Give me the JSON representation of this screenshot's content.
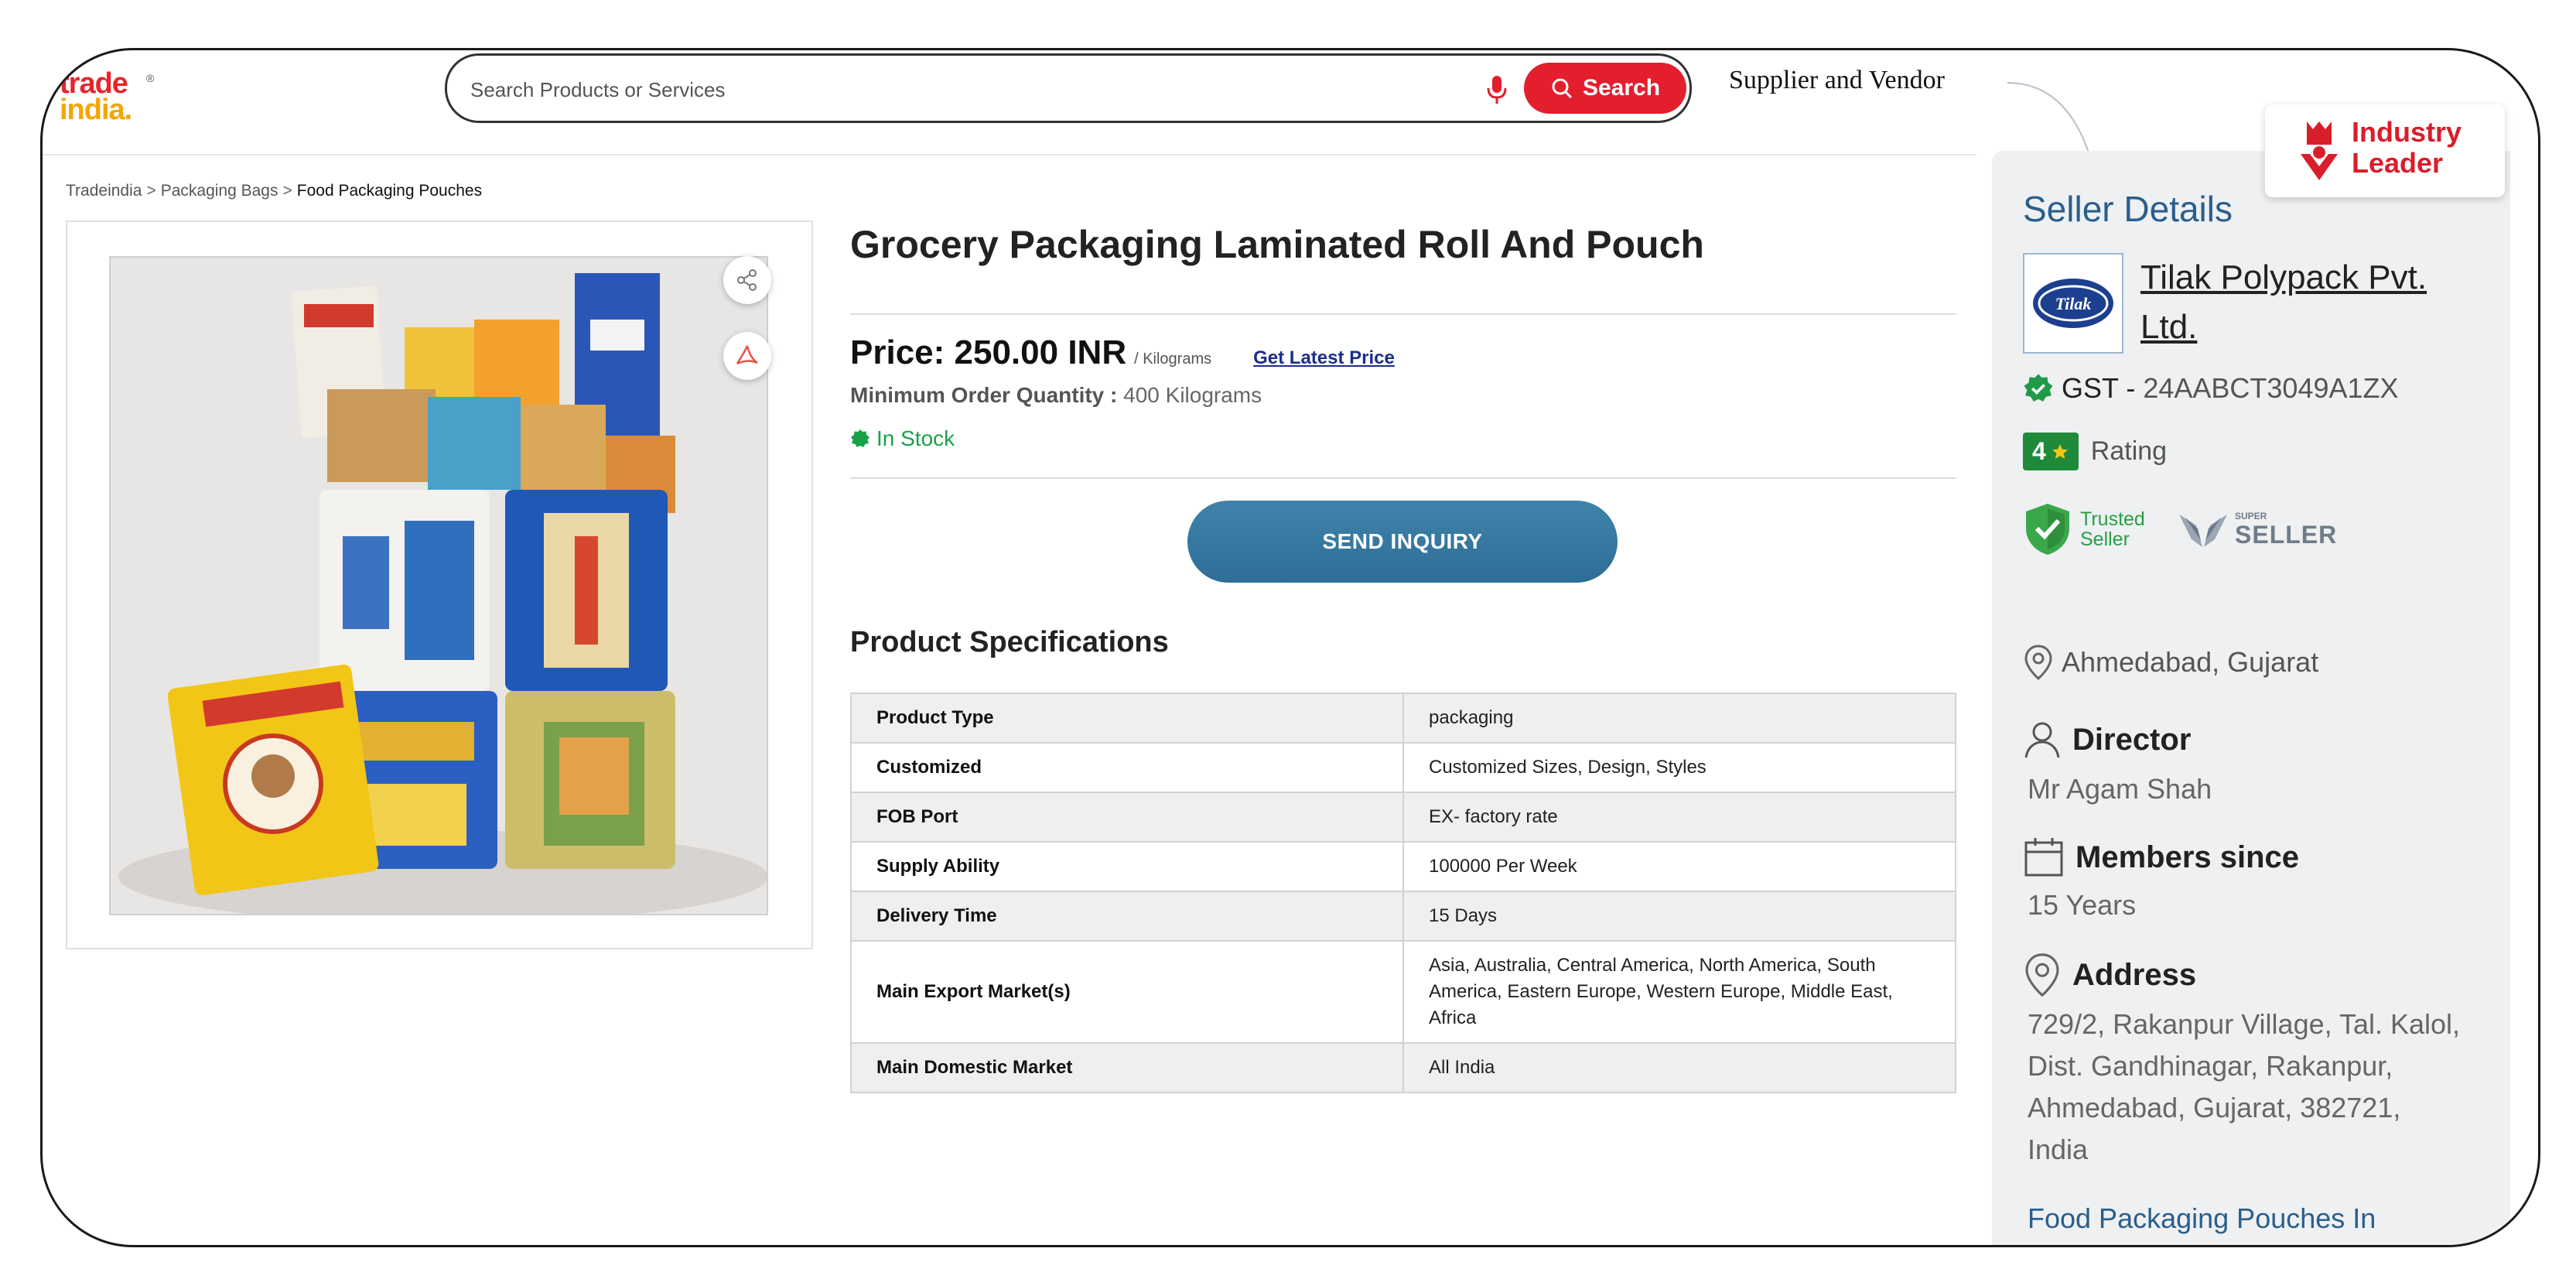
{
  "header": {
    "logo_line1": "trade",
    "logo_line2": "india.",
    "logo_reg": "®",
    "search_placeholder": "Search Products or Services",
    "search_button": "Search",
    "tagline": "Supplier and Vendor"
  },
  "breadcrumb": {
    "items": [
      "Tradeindia",
      "Packaging Bags",
      "Food Packaging Pouches"
    ],
    "separator": ">"
  },
  "product": {
    "title": "Grocery Packaging Laminated Roll And Pouch",
    "price": "Price: 250.00 INR",
    "price_unit": "/ Kilograms",
    "latest_price_link": "Get Latest Price",
    "moq_label": "Minimum Order Quantity :",
    "moq_value": "400 Kilograms",
    "stock": "In Stock",
    "inquiry_button": "SEND INQUIRY",
    "spec_title": "Product Specifications",
    "specs": [
      {
        "key": "Product Type",
        "value": "packaging"
      },
      {
        "key": "Customized",
        "value": "Customized Sizes, Design, Styles"
      },
      {
        "key": "FOB Port",
        "value": "EX- factory rate"
      },
      {
        "key": "Supply Ability",
        "value": "100000 Per Week"
      },
      {
        "key": "Delivery Time",
        "value": "15 Days"
      },
      {
        "key": "Main Export Market(s)",
        "value": "Asia, Australia, Central America, North America, South America, Eastern Europe, Western Europe, Middle East, Africa"
      },
      {
        "key": "Main Domestic Market",
        "value": "All India"
      }
    ]
  },
  "seller": {
    "badge_line1": "Industry",
    "badge_line2": "Leader",
    "heading": "Seller Details",
    "logo_text": "Tilak",
    "name": "Tilak Polypack Pvt. Ltd.",
    "gst_label": "GST -",
    "gst_value": "24AABCT3049A1ZX",
    "rating_value": "4",
    "rating_label": "Rating",
    "trusted_line1": "Trusted",
    "trusted_line2": "Seller",
    "super_small": "SUPER",
    "super_big": "SELLER",
    "location": "Ahmedabad, Gujarat",
    "director_label": "Director",
    "director_value": "Mr Agam Shah",
    "members_label": "Members since",
    "members_value": "15 Years",
    "address_label": "Address",
    "address_value": "729/2, Rakanpur Village, Tal. Kalol, Dist. Gandhinagar, Rakanpur, Ahmedabad, Gujarat, 382721, India",
    "more_link": "Food Packaging Pouches In Ahmedabad"
  },
  "colors": {
    "brand_red": "#e31e2d",
    "brand_orange": "#f5a500",
    "inquiry_blue": "#3a7ca4",
    "seller_blue": "#2a5e8c",
    "stock_green": "#1aa14a"
  }
}
